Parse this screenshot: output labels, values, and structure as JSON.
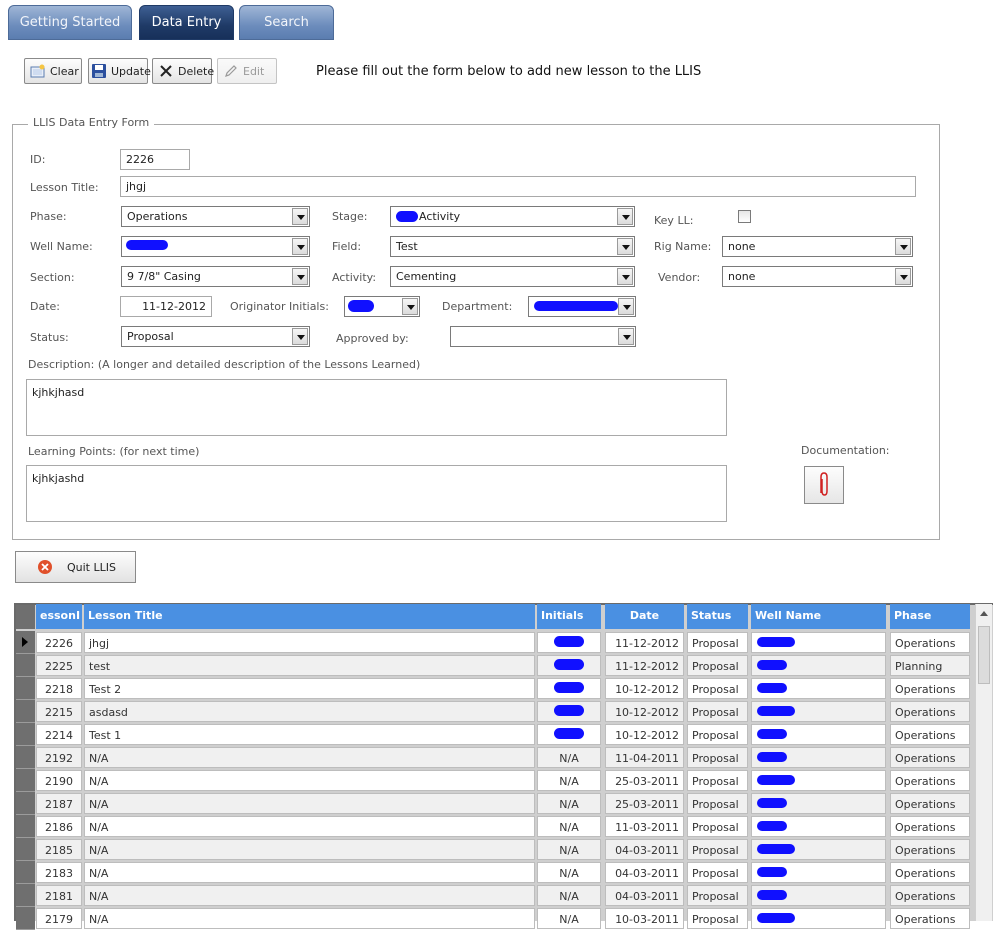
{
  "tabs": [
    {
      "label": "Getting Started",
      "active": false
    },
    {
      "label": "Data Entry",
      "active": true
    },
    {
      "label": "Search",
      "active": false
    }
  ],
  "toolbar": {
    "clear_label": "Clear",
    "update_label": "Update",
    "delete_label": "Delete",
    "edit_label": "Edit",
    "instructions": "Please fill out the form below to add new lesson to the LLIS"
  },
  "form": {
    "legend": "LLIS Data Entry Form",
    "id": {
      "label": "ID:",
      "value": "2226"
    },
    "lesson_title": {
      "label": "Lesson Title:",
      "value": "jhgj"
    },
    "phase": {
      "label": "Phase:",
      "value": "Operations"
    },
    "stage": {
      "label": "Stage:",
      "value": "Activity"
    },
    "key_ll": {
      "label": "Key LL:",
      "checked": false
    },
    "well_name": {
      "label": "Well Name:",
      "value": ""
    },
    "field": {
      "label": "Field:",
      "value": "Test"
    },
    "rig_name": {
      "label": "Rig Name:",
      "value": "none"
    },
    "section": {
      "label": "Section:",
      "value": "9 7/8\" Casing"
    },
    "activity": {
      "label": "Activity:",
      "value": "Cementing"
    },
    "vendor": {
      "label": "Vendor:",
      "value": "none"
    },
    "date": {
      "label": "Date:",
      "value": "11-12-2012"
    },
    "originator": {
      "label": "Originator Initials:",
      "value": ""
    },
    "department": {
      "label": "Department:",
      "value": ""
    },
    "status": {
      "label": "Status:",
      "value": "Proposal"
    },
    "approved_by": {
      "label": "Approved by:",
      "value": ""
    },
    "description": {
      "label": "Description: (A longer and detailed description of the Lessons Learned)",
      "value": "kjhkjhasd"
    },
    "learning_points": {
      "label": "Learning Points: (for next time)",
      "value": "kjhkjashd"
    },
    "documentation": {
      "label": "Documentation:"
    }
  },
  "quit_label": "Quit LLIS",
  "grid": {
    "columns": [
      "essonI",
      "Lesson Title",
      "Initials",
      "Date",
      "Status",
      "Well Name",
      "Phase"
    ],
    "rows": [
      {
        "id": "2226",
        "title": "jhgj",
        "initials": "",
        "date": "11-12-2012",
        "status": "Proposal",
        "well": "",
        "phase": "Operations"
      },
      {
        "id": "2225",
        "title": "test",
        "initials": "",
        "date": "11-12-2012",
        "status": "Proposal",
        "well": "",
        "phase": "Planning"
      },
      {
        "id": "2218",
        "title": "Test 2",
        "initials": "",
        "date": "10-12-2012",
        "status": "Proposal",
        "well": "",
        "phase": "Operations"
      },
      {
        "id": "2215",
        "title": "asdasd",
        "initials": "",
        "date": "10-12-2012",
        "status": "Proposal",
        "well": "",
        "phase": "Operations"
      },
      {
        "id": "2214",
        "title": "Test 1",
        "initials": "",
        "date": "10-12-2012",
        "status": "Proposal",
        "well": "",
        "phase": "Operations"
      },
      {
        "id": "2192",
        "title": "N/A",
        "initials": "N/A",
        "date": "11-04-2011",
        "status": "Proposal",
        "well": "",
        "phase": "Operations"
      },
      {
        "id": "2190",
        "title": "N/A",
        "initials": "N/A",
        "date": "25-03-2011",
        "status": "Proposal",
        "well": "",
        "phase": "Operations"
      },
      {
        "id": "2187",
        "title": "N/A",
        "initials": "N/A",
        "date": "25-03-2011",
        "status": "Proposal",
        "well": "",
        "phase": "Operations"
      },
      {
        "id": "2186",
        "title": "N/A",
        "initials": "N/A",
        "date": "11-03-2011",
        "status": "Proposal",
        "well": "",
        "phase": "Operations"
      },
      {
        "id": "2185",
        "title": "N/A",
        "initials": "N/A",
        "date": "04-03-2011",
        "status": "Proposal",
        "well": "",
        "phase": "Operations"
      },
      {
        "id": "2183",
        "title": "N/A",
        "initials": "N/A",
        "date": "04-03-2011",
        "status": "Proposal",
        "well": "",
        "phase": "Operations"
      },
      {
        "id": "2181",
        "title": "N/A",
        "initials": "N/A",
        "date": "04-03-2011",
        "status": "Proposal",
        "well": "",
        "phase": "Operations"
      },
      {
        "id": "2179",
        "title": "N/A",
        "initials": "N/A",
        "date": "10-03-2011",
        "status": "Proposal",
        "well": "",
        "phase": "Operations"
      }
    ]
  }
}
